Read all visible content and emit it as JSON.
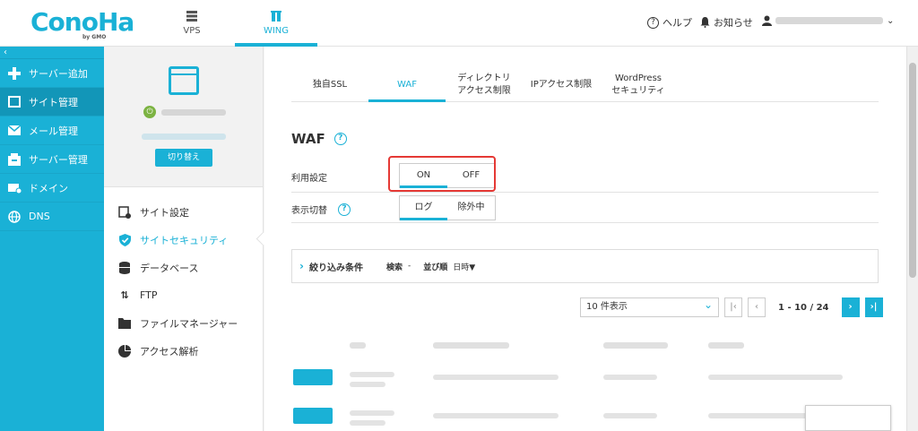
{
  "header": {
    "logo": "ConoHa",
    "logo_sub": "by GMO",
    "tabs": [
      {
        "label": "VPS",
        "icon": "server-icon"
      },
      {
        "label": "WING",
        "icon": "wing-icon"
      }
    ],
    "help_label": "ヘルプ",
    "notice_label": "お知らせ"
  },
  "leftnav": {
    "collapse": "‹",
    "items": [
      {
        "label": "サーバー追加",
        "icon": "plus-icon"
      },
      {
        "label": "サイト管理",
        "icon": "window-icon"
      },
      {
        "label": "メール管理",
        "icon": "mail-icon"
      },
      {
        "label": "サーバー管理",
        "icon": "server-stack-icon"
      },
      {
        "label": "ドメイン",
        "icon": "domain-icon"
      },
      {
        "label": "DNS",
        "icon": "globe-icon"
      }
    ]
  },
  "subnav": {
    "switch_label": "切り替え",
    "items": [
      {
        "label": "サイト設定",
        "icon": "site-settings-icon"
      },
      {
        "label": "サイトセキュリティ",
        "icon": "shield-icon"
      },
      {
        "label": "データベース",
        "icon": "database-icon"
      },
      {
        "label": "FTP",
        "icon": "transfer-icon"
      },
      {
        "label": "ファイルマネージャー",
        "icon": "folder-icon"
      },
      {
        "label": "アクセス解析",
        "icon": "pie-chart-icon"
      }
    ]
  },
  "main": {
    "tabs": [
      {
        "line1": "独自SSL",
        "line2": ""
      },
      {
        "line1": "WAF",
        "line2": ""
      },
      {
        "line1": "ディレクトリ",
        "line2": "アクセス制限"
      },
      {
        "line1": "IPアクセス制限",
        "line2": ""
      },
      {
        "line1": "WordPress",
        "line2": "セキュリティ"
      }
    ],
    "title": "WAF",
    "usage_label": "利用設定",
    "usage_on": "ON",
    "usage_off": "OFF",
    "display_label": "表示切替",
    "display_log": "ログ",
    "display_excluded": "除外中",
    "filter": {
      "title": "絞り込み条件",
      "search_label": "検索",
      "search_value": "-",
      "sort_label": "並び順",
      "sort_value": "日時▼"
    },
    "pager": {
      "per_page": "10 件表示",
      "range": "1 - 10 / 24"
    }
  }
}
